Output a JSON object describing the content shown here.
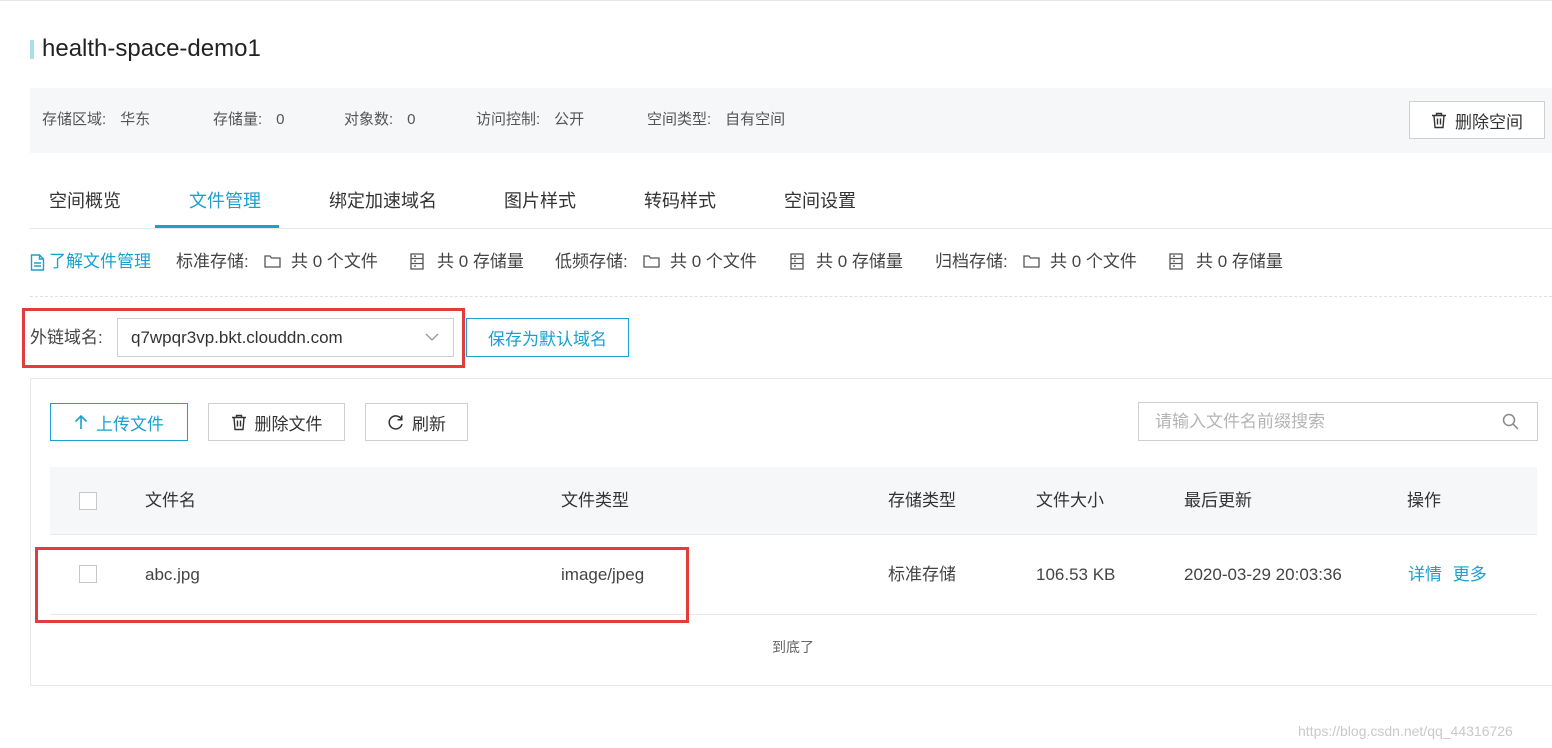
{
  "bucket": {
    "name": "health-space-demo1"
  },
  "info": {
    "region_label": "存储区域:",
    "region_value": "华东",
    "storage_label": "存储量:",
    "storage_value": "0",
    "objects_label": "对象数:",
    "objects_value": "0",
    "access_label": "访问控制:",
    "access_value": "公开",
    "type_label": "空间类型:",
    "type_value": "自有空间",
    "delete_space_label": "删除空间"
  },
  "tabs": [
    {
      "label": "空间概览"
    },
    {
      "label": "文件管理",
      "active": true
    },
    {
      "label": "绑定加速域名"
    },
    {
      "label": "图片样式"
    },
    {
      "label": "转码样式"
    },
    {
      "label": "空间设置"
    }
  ],
  "stats": {
    "learn_link": "了解文件管理",
    "standard_label": "标准存储:",
    "standard_files": "共 0 个文件",
    "standard_size": "共 0 存储量",
    "low_label": "低频存储:",
    "low_files": "共 0 个文件",
    "low_size": "共 0 存储量",
    "archive_label": "归档存储:",
    "archive_files": "共 0 个文件",
    "archive_size": "共 0 存储量"
  },
  "domain": {
    "label": "外链域名:",
    "selected": "q7wpqr3vp.bkt.clouddn.com",
    "save_default_label": "保存为默认域名"
  },
  "toolbar": {
    "upload_label": "上传文件",
    "delete_label": "删除文件",
    "refresh_label": "刷新",
    "search_placeholder": "请输入文件名前缀搜索"
  },
  "table": {
    "columns": [
      "文件名",
      "文件类型",
      "存储类型",
      "文件大小",
      "最后更新",
      "操作"
    ],
    "rows": [
      {
        "name": "abc.jpg",
        "type": "image/jpeg",
        "storage": "标准存储",
        "size": "106.53 KB",
        "updated": "2020-03-29 20:03:36",
        "action_detail": "详情",
        "action_more": "更多"
      }
    ],
    "end_text": "到底了"
  },
  "watermark": "https://blog.csdn.net/qq_44316726",
  "colors": {
    "accent": "#1aa0d1",
    "highlight": "#e23c3c"
  }
}
